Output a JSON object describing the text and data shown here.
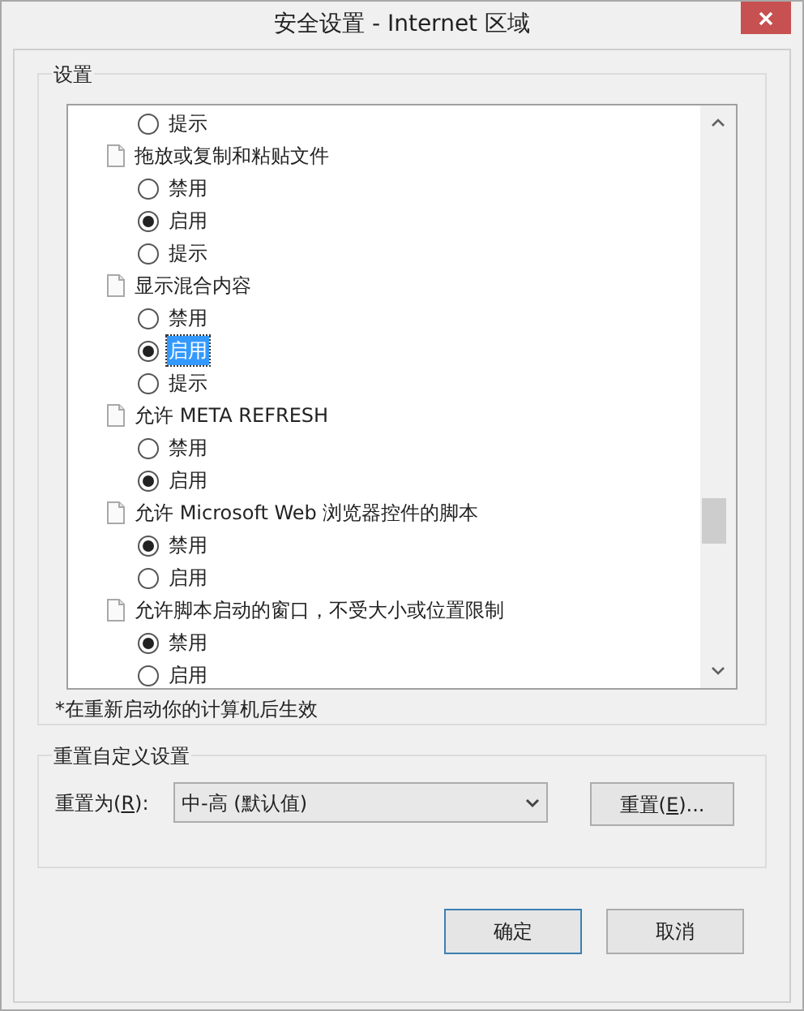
{
  "window": {
    "title": "安全设置 - Internet 区域"
  },
  "settings_group": {
    "label": "设置",
    "items": [
      {
        "kind": "option",
        "label": "提示",
        "checked": false,
        "selected": false
      },
      {
        "kind": "setting",
        "label": "拖放或复制和粘贴文件"
      },
      {
        "kind": "option",
        "label": "禁用",
        "checked": false,
        "selected": false
      },
      {
        "kind": "option",
        "label": "启用",
        "checked": true,
        "selected": false
      },
      {
        "kind": "option",
        "label": "提示",
        "checked": false,
        "selected": false
      },
      {
        "kind": "setting",
        "label": "显示混合内容"
      },
      {
        "kind": "option",
        "label": "禁用",
        "checked": false,
        "selected": false
      },
      {
        "kind": "option",
        "label": "启用",
        "checked": true,
        "selected": true
      },
      {
        "kind": "option",
        "label": "提示",
        "checked": false,
        "selected": false
      },
      {
        "kind": "setting",
        "label": "允许 META REFRESH"
      },
      {
        "kind": "option",
        "label": "禁用",
        "checked": false,
        "selected": false
      },
      {
        "kind": "option",
        "label": "启用",
        "checked": true,
        "selected": false
      },
      {
        "kind": "setting",
        "label": "允许 Microsoft Web 浏览器控件的脚本"
      },
      {
        "kind": "option",
        "label": "禁用",
        "checked": true,
        "selected": false
      },
      {
        "kind": "option",
        "label": "启用",
        "checked": false,
        "selected": false
      },
      {
        "kind": "setting",
        "label": "允许脚本启动的窗口，不受大小或位置限制"
      },
      {
        "kind": "option",
        "label": "禁用",
        "checked": true,
        "selected": false
      },
      {
        "kind": "option",
        "label": "启用",
        "checked": false,
        "selected": false
      }
    ],
    "note": "*在重新启动你的计算机后生效"
  },
  "reset_group": {
    "label": "重置自定义设置",
    "field_label": "重置为(**R**):",
    "value": "中-高 (默认值)",
    "button": "重置(**E**)..."
  },
  "buttons": [
    "确定",
    "取消"
  ]
}
